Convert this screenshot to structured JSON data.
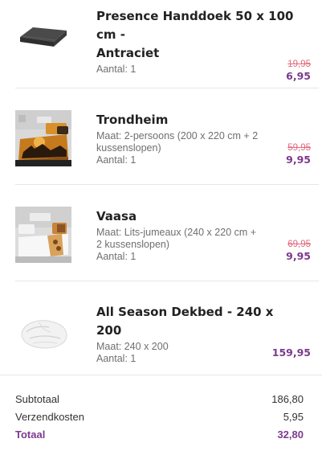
{
  "colors": {
    "accent": "#7c3a8e",
    "old_price": "#e0697d",
    "divider": "#e6e6e6"
  },
  "items": [
    {
      "title_line1": "Presence Handdoek 50 x 100 cm -",
      "title_line2": "Antraciet",
      "meta": [
        "Aantal: 1"
      ],
      "old_price": "19,95",
      "price": "6,95",
      "image": "towel-image"
    },
    {
      "title_line1": "Trondheim",
      "title_line2": "",
      "meta": [
        "Maat: 2-persoons (200 x 220 cm + 2",
        "kussenslopen)",
        "Aantal: 1"
      ],
      "old_price": "59,95",
      "price": "9,95",
      "image": "duvet-cover-image"
    },
    {
      "title_line1": "Vaasa",
      "title_line2": "",
      "meta": [
        "Maat: Lits-jumeaux (240 x 220 cm +",
        "2 kussenslopen)",
        "Aantal: 1"
      ],
      "old_price": "69,95",
      "price": "9,95",
      "image": "duvet-cover-image"
    },
    {
      "title_line1": "All Season Dekbed - 240 x 200",
      "title_line2": "",
      "meta": [
        "Maat: 240 x 200",
        "Aantal: 1"
      ],
      "old_price": "",
      "price": "159,95",
      "image": "duvet-image"
    }
  ],
  "summary": {
    "subtotal_label": "Subtotaal",
    "subtotal_value": "186,80",
    "shipping_label": "Verzendkosten",
    "shipping_value": "5,95",
    "total_label": "Totaal",
    "total_value": "32,80"
  }
}
